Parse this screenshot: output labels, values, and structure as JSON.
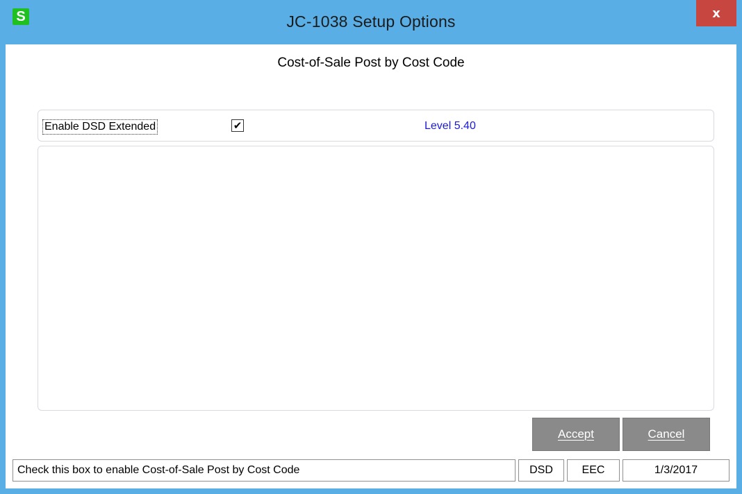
{
  "window": {
    "title": "JC-1038 Setup Options",
    "app_icon_label": "S",
    "close_label": "x"
  },
  "main": {
    "heading": "Cost-of-Sale Post by Cost Code",
    "option": {
      "label": "Enable DSD Extended",
      "checked": true,
      "check_glyph": "✔",
      "level_text": "Level  5.40"
    }
  },
  "buttons": {
    "accept_label": "Accept",
    "cancel_label": "Cancel"
  },
  "statusbar": {
    "message": "Check this box to enable Cost-of-Sale Post by Cost Code",
    "company": "DSD",
    "user": "EEC",
    "date": "1/3/2017"
  },
  "colors": {
    "titlebar": "#59aee6",
    "close_button": "#c7463f",
    "level_text": "#1a1ad6",
    "button_bg": "#8a8a8a"
  }
}
